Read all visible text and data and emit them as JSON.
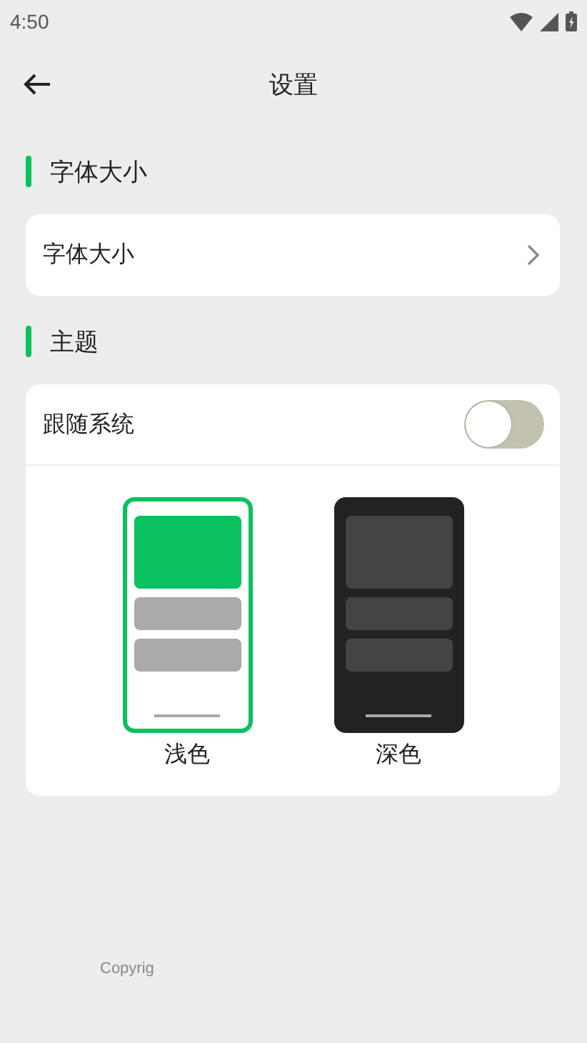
{
  "status_bar": {
    "time": "4:50"
  },
  "header": {
    "title": "设置"
  },
  "sections": [
    {
      "title": "字体大小",
      "kind": "link",
      "label": "字体大小"
    },
    {
      "title": "主题",
      "kind": "theme",
      "follow_system": {
        "label": "跟随系统",
        "on": false
      },
      "themes": [
        {
          "kind": "light",
          "label": "浅色",
          "selected": true
        },
        {
          "kind": "dark",
          "label": "深色",
          "selected": false
        }
      ]
    }
  ],
  "footer": {
    "text": "Copyrig"
  }
}
